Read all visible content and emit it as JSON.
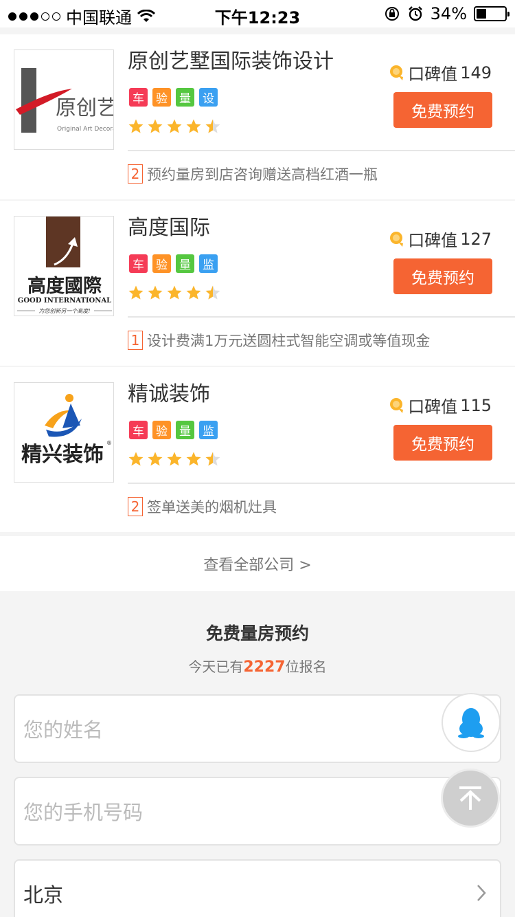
{
  "status_bar": {
    "carrier": "中国联通",
    "time": "下午12:23",
    "battery": "34%",
    "signal_strength": 3,
    "battery_level": 0.34
  },
  "companies": [
    {
      "name": "原创艺墅国际装饰设计",
      "tags": [
        "车",
        "验",
        "量",
        "设"
      ],
      "rating": 4.5,
      "reputation_label": "口碑值",
      "reputation_value": "149",
      "book_label": "免费预约",
      "promo_count": "2",
      "promo_text": "预约量房到店咨询赠送高档红酒一瓶",
      "logo": {
        "main": "原创艺墅",
        "sub": "Original Art Decoration"
      }
    },
    {
      "name": "高度国际",
      "tags": [
        "车",
        "验",
        "量",
        "监"
      ],
      "rating": 4.5,
      "reputation_label": "口碑值",
      "reputation_value": "127",
      "book_label": "免费预约",
      "promo_count": "1",
      "promo_text": "设计费满1万元送圆柱式智能空调或等值现金",
      "logo": {
        "main": "高度國際",
        "sub": "GOOD INTERNATIONAL",
        "slogan": "为您创新另一个高度!"
      }
    },
    {
      "name": "精诚装饰",
      "tags": [
        "车",
        "验",
        "量",
        "监"
      ],
      "rating": 4.5,
      "reputation_label": "口碑值",
      "reputation_value": "115",
      "book_label": "免费预约",
      "promo_count": "2",
      "promo_text": "签单送美的烟机灶具",
      "logo": {
        "main": "精兴装饰",
        "mark": "®"
      }
    }
  ],
  "view_all_label": "查看全部公司 >",
  "form": {
    "title": "免费量房预约",
    "count_prefix": "今天已有",
    "count_value": "2227",
    "count_suffix": "位报名",
    "name_placeholder": "您的姓名",
    "phone_placeholder": "您的手机号码",
    "city_value": "北京"
  },
  "colors": {
    "accent": "#f56433",
    "tag_red": "#f53b56",
    "tag_orange": "#fe9226",
    "tag_green": "#55c740",
    "tag_blue": "#3aa0f1",
    "star": "#fbb52b"
  }
}
